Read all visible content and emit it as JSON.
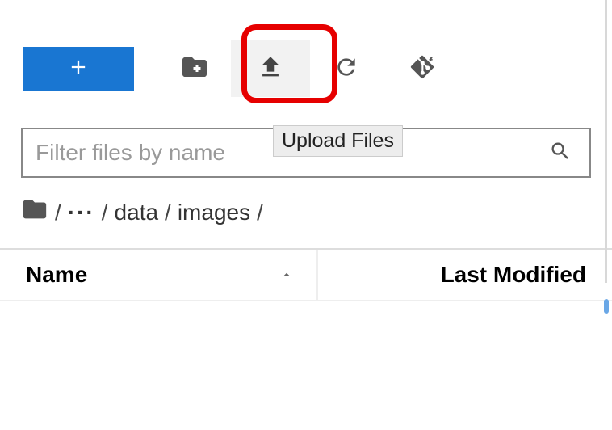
{
  "toolbar": {
    "new_label": "New",
    "new_folder_label": "New Folder",
    "upload_label": "Upload Files",
    "refresh_label": "Refresh",
    "git_label": "Git"
  },
  "tooltip": {
    "upload": "Upload Files"
  },
  "search": {
    "placeholder": "Filter files by name"
  },
  "breadcrumb": {
    "root": "/",
    "ellipsis": "···",
    "sep1": "/",
    "seg1": "data",
    "sep2": "/",
    "seg2": "images",
    "sep3": "/"
  },
  "table": {
    "col_name": "Name",
    "col_modified": "Last Modified"
  },
  "colors": {
    "primary": "#1976d2",
    "highlight": "#e60000"
  }
}
